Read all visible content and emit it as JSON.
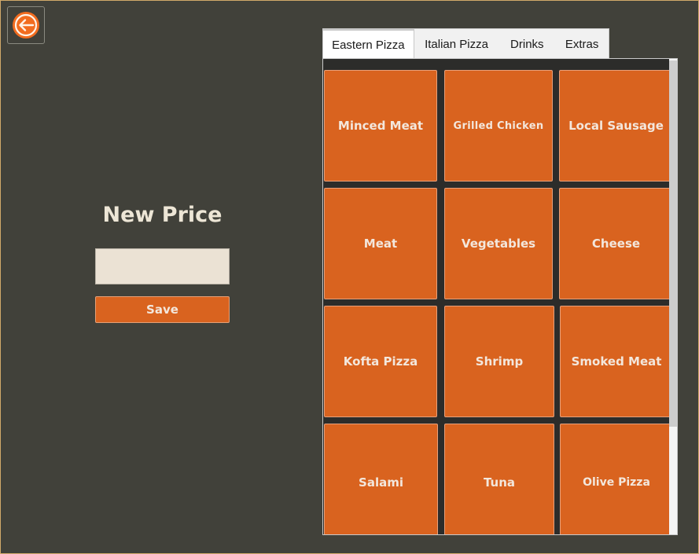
{
  "window": {
    "back_icon": "arrow-left-circle-icon"
  },
  "price_panel": {
    "title": "New Price",
    "input_value": "",
    "save_label": "Save"
  },
  "tabs": [
    {
      "label": "Eastern Pizza",
      "active": true
    },
    {
      "label": "Italian Pizza",
      "active": false
    },
    {
      "label": "Drinks",
      "active": false
    },
    {
      "label": "Extras",
      "active": false
    }
  ],
  "items": [
    "Minced Meat",
    "Grilled Chicken",
    "Local Sausage",
    "Meat",
    "Vegetables",
    "Cheese",
    "Kofta Pizza",
    "Shrimp",
    "Smoked Meat",
    "Salami",
    "Tuna",
    "Olive Pizza"
  ],
  "colors": {
    "background": "#41413a",
    "accent": "#d9631f",
    "tile_text": "#f3e7dc"
  }
}
